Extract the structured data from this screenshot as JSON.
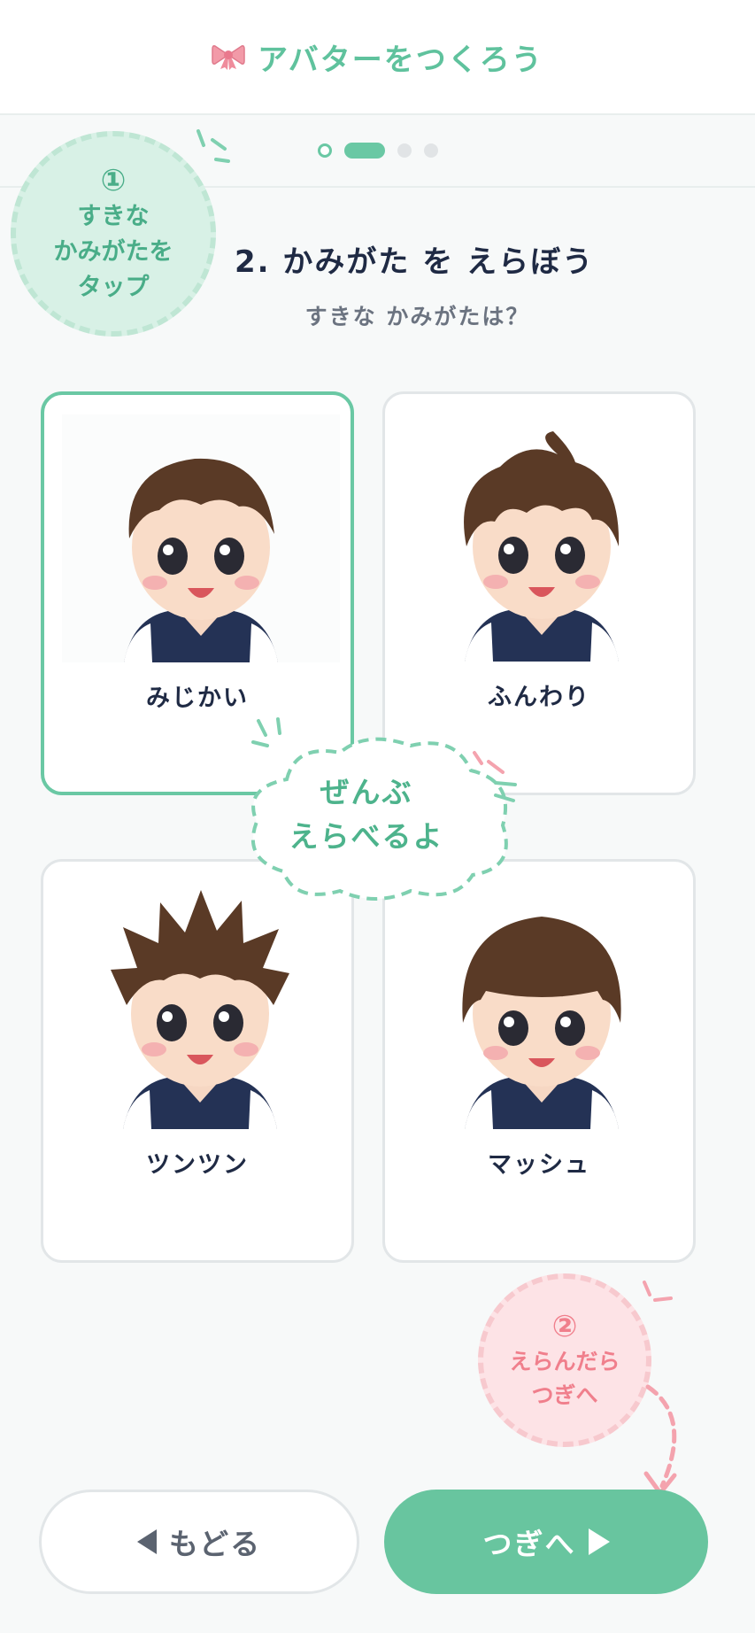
{
  "header": {
    "title": "アバターをつくろう",
    "icon": "ribbon-icon"
  },
  "stepper": {
    "steps": 4,
    "current": 2
  },
  "hint_top": {
    "number": "①",
    "line1": "すきな",
    "line2": "かみがたを",
    "line3": "タップ"
  },
  "question": {
    "title": "2. かみがた を えらぼう",
    "subtitle": "すきな かみがたは？"
  },
  "options": [
    {
      "label": "みじかい",
      "selected": true
    },
    {
      "label": "ふんわり",
      "selected": false
    },
    {
      "label": "ツンツン",
      "selected": false
    },
    {
      "label": "マッシュ",
      "selected": false
    }
  ],
  "cloud": {
    "line1": "ぜんぶ",
    "line2": "えらべるよ"
  },
  "hint_bottom": {
    "number": "②",
    "line1": "えらんだら",
    "line2": "つぎへ"
  },
  "buttons": {
    "back": "もどる",
    "next": "つぎへ"
  },
  "colors": {
    "accent": "#68c59f",
    "pink": "#f07f8c",
    "text": "#1f2a44"
  }
}
